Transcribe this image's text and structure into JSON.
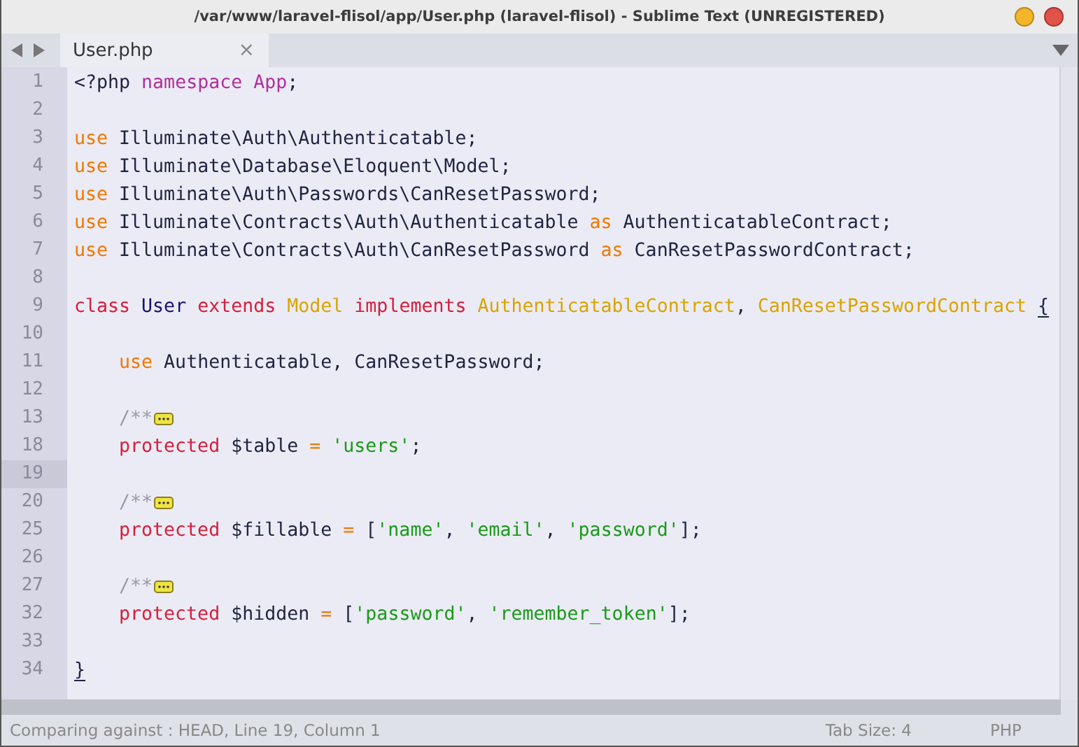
{
  "window": {
    "title": "/var/www/laravel-flisol/app/User.php (laravel-flisol) - Sublime Text (UNREGISTERED)"
  },
  "tabs": [
    {
      "label": "User.php",
      "selected": true,
      "close": "×"
    }
  ],
  "editor": {
    "lines": [
      {
        "number": "1",
        "current": false,
        "tokens": [
          {
            "kind": "plain",
            "text": "<?php "
          },
          {
            "kind": "namespace",
            "text": "namespace App"
          },
          {
            "kind": "plain",
            "text": ";"
          }
        ]
      },
      {
        "number": "2",
        "current": false
      },
      {
        "number": "3",
        "current": false,
        "tokens": [
          {
            "kind": "keyword",
            "text": "use"
          },
          {
            "kind": "plain",
            "text": " Illuminate\\Auth\\Authenticatable;"
          }
        ]
      },
      {
        "number": "4",
        "current": false,
        "tokens": [
          {
            "kind": "keyword",
            "text": "use"
          },
          {
            "kind": "plain",
            "text": " Illuminate\\Database\\Eloquent\\Model;"
          }
        ]
      },
      {
        "number": "5",
        "current": false,
        "tokens": [
          {
            "kind": "keyword",
            "text": "use"
          },
          {
            "kind": "plain",
            "text": " Illuminate\\Auth\\Passwords\\CanResetPassword;"
          }
        ]
      },
      {
        "number": "6",
        "current": false,
        "tokens": [
          {
            "kind": "keyword",
            "text": "use"
          },
          {
            "kind": "plain",
            "text": " Illuminate\\Contracts\\Auth\\Authenticatable "
          },
          {
            "kind": "keyword",
            "text": "as"
          },
          {
            "kind": "plain",
            "text": " AuthenticatableContract;"
          }
        ]
      },
      {
        "number": "7",
        "current": false,
        "tokens": [
          {
            "kind": "keyword",
            "text": "use"
          },
          {
            "kind": "plain",
            "text": " Illuminate\\Contracts\\Auth\\CanResetPassword "
          },
          {
            "kind": "keyword",
            "text": "as"
          },
          {
            "kind": "plain",
            "text": " CanResetPasswordContract;"
          }
        ]
      },
      {
        "number": "8",
        "current": false
      },
      {
        "number": "9",
        "current": false,
        "tokens": [
          {
            "kind": "storage",
            "text": "class "
          },
          {
            "kind": "classname",
            "text": "User "
          },
          {
            "kind": "storage",
            "text": "extends "
          },
          {
            "kind": "inherited",
            "text": "Model "
          },
          {
            "kind": "storage",
            "text": "implements "
          },
          {
            "kind": "inherited",
            "text": "AuthenticatableContract"
          },
          {
            "kind": "plain",
            "text": ", "
          },
          {
            "kind": "inherited",
            "text": "CanResetPasswordContract "
          },
          {
            "kind": "bracket",
            "text": "{"
          }
        ]
      },
      {
        "number": "10",
        "current": false
      },
      {
        "number": "11",
        "current": false,
        "tokens": [
          {
            "kind": "keyword",
            "text": "    use"
          },
          {
            "kind": "plain",
            "text": " Authenticatable, CanResetPassword;"
          }
        ]
      },
      {
        "number": "12",
        "current": false
      },
      {
        "number": "13",
        "current": false,
        "tokens": [
          {
            "kind": "comment",
            "text": "    /**"
          },
          {
            "kind": "fold"
          }
        ]
      },
      {
        "number": "18",
        "current": false,
        "tokens": [
          {
            "kind": "storage",
            "text": "    protected"
          },
          {
            "kind": "plain",
            "text": " $table "
          },
          {
            "kind": "keyword",
            "text": "= "
          },
          {
            "kind": "string",
            "text": "'users'"
          },
          {
            "kind": "plain",
            "text": ";"
          }
        ]
      },
      {
        "number": "19",
        "current": true
      },
      {
        "number": "20",
        "current": false,
        "tokens": [
          {
            "kind": "comment",
            "text": "    /**"
          },
          {
            "kind": "fold"
          }
        ]
      },
      {
        "number": "25",
        "current": false,
        "tokens": [
          {
            "kind": "storage",
            "text": "    protected"
          },
          {
            "kind": "plain",
            "text": " $fillable "
          },
          {
            "kind": "keyword",
            "text": "="
          },
          {
            "kind": "plain",
            "text": " ["
          },
          {
            "kind": "string",
            "text": "'name'"
          },
          {
            "kind": "plain",
            "text": ", "
          },
          {
            "kind": "string",
            "text": "'email'"
          },
          {
            "kind": "plain",
            "text": ", "
          },
          {
            "kind": "string",
            "text": "'password'"
          },
          {
            "kind": "plain",
            "text": "];"
          }
        ]
      },
      {
        "number": "26",
        "current": false
      },
      {
        "number": "27",
        "current": false,
        "tokens": [
          {
            "kind": "comment",
            "text": "    /**"
          },
          {
            "kind": "fold"
          }
        ]
      },
      {
        "number": "32",
        "current": false,
        "tokens": [
          {
            "kind": "storage",
            "text": "    protected"
          },
          {
            "kind": "plain",
            "text": " $hidden "
          },
          {
            "kind": "keyword",
            "text": "="
          },
          {
            "kind": "plain",
            "text": " ["
          },
          {
            "kind": "string",
            "text": "'password'"
          },
          {
            "kind": "plain",
            "text": ", "
          },
          {
            "kind": "string",
            "text": "'remember_token'"
          },
          {
            "kind": "plain",
            "text": "];"
          }
        ]
      },
      {
        "number": "33",
        "current": false
      },
      {
        "number": "34",
        "current": false,
        "tokens": [
          {
            "kind": "bracket",
            "text": "}"
          }
        ]
      }
    ]
  },
  "status_bar": {
    "position": "Comparing against : HEAD, Line 19, Column 1",
    "tab_size": "Tab Size: 4",
    "syntax": "PHP"
  }
}
